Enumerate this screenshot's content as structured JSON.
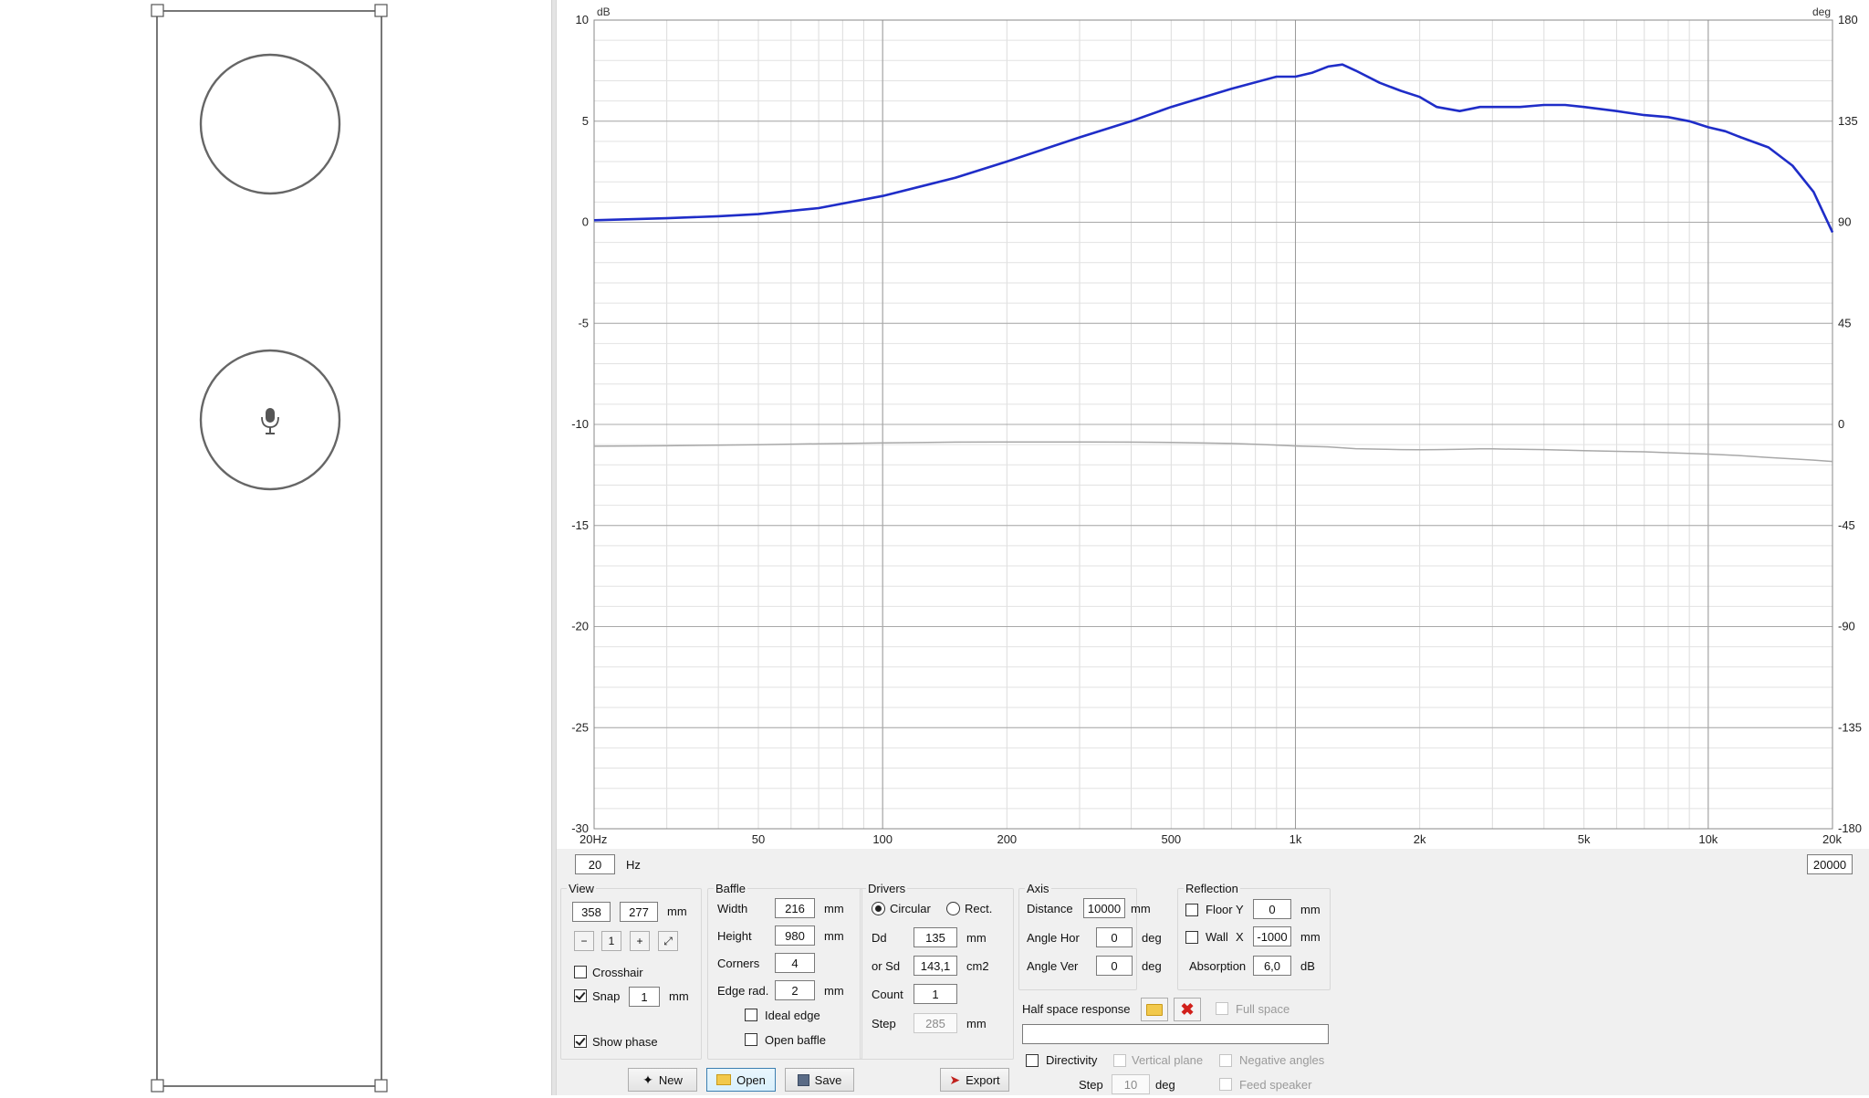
{
  "chart_data": {
    "type": "line",
    "x_scale": "log",
    "xlim": [
      20,
      20000
    ],
    "ylim": [
      -30,
      10
    ],
    "y2lim": [
      -180,
      180
    ],
    "ylabel": "dB",
    "y2label": "deg",
    "grid": true,
    "x_ticks": [
      {
        "v": 20,
        "label": "20Hz"
      },
      {
        "v": 50,
        "label": "50"
      },
      {
        "v": 100,
        "label": "100"
      },
      {
        "v": 200,
        "label": "200"
      },
      {
        "v": 500,
        "label": "500"
      },
      {
        "v": 1000,
        "label": "1k"
      },
      {
        "v": 2000,
        "label": "2k"
      },
      {
        "v": 5000,
        "label": "5k"
      },
      {
        "v": 10000,
        "label": "10k"
      },
      {
        "v": 20000,
        "label": "20k"
      }
    ],
    "y_ticks": [
      {
        "v": 10,
        "label": "10"
      },
      {
        "v": 5,
        "label": "5"
      },
      {
        "v": 0,
        "label": "0"
      },
      {
        "v": -5,
        "label": "-5"
      },
      {
        "v": -10,
        "label": "-10"
      },
      {
        "v": -15,
        "label": "-15"
      },
      {
        "v": -20,
        "label": "-20"
      },
      {
        "v": -25,
        "label": "-25"
      },
      {
        "v": -30,
        "label": "-30"
      }
    ],
    "y2_ticks": [
      {
        "v": 180,
        "label": "180"
      },
      {
        "v": 135,
        "label": "135"
      },
      {
        "v": 90,
        "label": "90"
      },
      {
        "v": 45,
        "label": "45"
      },
      {
        "v": 0,
        "label": "0"
      },
      {
        "v": -45,
        "label": "-45"
      },
      {
        "v": -90,
        "label": "-90"
      },
      {
        "v": -135,
        "label": "-135"
      },
      {
        "v": -180,
        "label": "-180"
      }
    ],
    "series": [
      {
        "axis": "left",
        "color": "#1f2dc8",
        "x": [
          20,
          30,
          40,
          50,
          70,
          100,
          150,
          200,
          300,
          400,
          500,
          700,
          900,
          1000,
          1100,
          1200,
          1300,
          1400,
          1600,
          1800,
          2000,
          2200,
          2500,
          2800,
          3000,
          3500,
          4000,
          4500,
          5000,
          6000,
          7000,
          8000,
          9000,
          10000,
          11000,
          12000,
          14000,
          16000,
          18000,
          20000
        ],
        "y": [
          0.1,
          0.2,
          0.3,
          0.4,
          0.7,
          1.3,
          2.2,
          3.0,
          4.2,
          5.0,
          5.7,
          6.6,
          7.2,
          7.2,
          7.4,
          7.7,
          7.8,
          7.5,
          6.9,
          6.5,
          6.2,
          5.7,
          5.5,
          5.7,
          5.7,
          5.7,
          5.8,
          5.8,
          5.7,
          5.5,
          5.3,
          5.2,
          5.0,
          4.7,
          4.5,
          4.2,
          3.7,
          2.8,
          1.5,
          -0.5
        ]
      },
      {
        "axis": "right",
        "color": "#a8a8a8",
        "x": [
          20,
          30,
          50,
          70,
          100,
          150,
          200,
          300,
          400,
          500,
          700,
          800,
          1000,
          1200,
          1400,
          1600,
          1800,
          2000,
          2200,
          2500,
          2800,
          3000,
          3500,
          4000,
          5000,
          6000,
          7000,
          8000,
          10000,
          12000,
          14000,
          16000,
          18000,
          20000
        ],
        "y": [
          -9.7,
          -9.5,
          -9.0,
          -8.6,
          -8.2,
          -7.9,
          -7.8,
          -7.8,
          -7.9,
          -8.0,
          -8.5,
          -8.8,
          -9.6,
          -10.0,
          -10.8,
          -11.0,
          -11.2,
          -11.3,
          -11.2,
          -11.1,
          -10.9,
          -10.9,
          -11.1,
          -11.2,
          -11.7,
          -12.0,
          -12.2,
          -12.6,
          -13.2,
          -13.9,
          -14.7,
          -15.3,
          -15.9,
          -16.5
        ]
      }
    ]
  },
  "baffle_view": {
    "mic_icon": "microphone-icon"
  },
  "range": {
    "min": "20",
    "min_unit": "Hz",
    "max": "20000"
  },
  "view": {
    "title": "View",
    "x": "358",
    "y": "277",
    "unit": "mm",
    "crosshair_label": "Crosshair",
    "crosshair_checked": false,
    "snap_label": "Snap",
    "snap_checked": true,
    "snap_value": "1",
    "snap_unit": "mm",
    "show_phase_label": "Show phase",
    "show_phase_checked": true
  },
  "baffle": {
    "title": "Baffle",
    "width_label": "Width",
    "width": "216",
    "height_label": "Height",
    "height": "980",
    "corners_label": "Corners",
    "corners": "4",
    "edge_rad_label": "Edge rad.",
    "edge_rad": "2",
    "unit": "mm",
    "ideal_edge_label": "Ideal edge",
    "open_baffle_label": "Open baffle"
  },
  "drivers": {
    "title": "Drivers",
    "circular_label": "Circular",
    "rect_label": "Rect.",
    "dd_label": "Dd",
    "dd": "135",
    "dd_unit": "mm",
    "sd_label": "or Sd",
    "sd": "143,1",
    "sd_unit": "cm2",
    "count_label": "Count",
    "count": "1",
    "step_label": "Step",
    "step": "285",
    "step_unit": "mm"
  },
  "axis": {
    "title": "Axis",
    "distance_label": "Distance",
    "distance": "10000",
    "distance_unit": "mm",
    "angle_hor_label": "Angle Hor",
    "angle_hor": "0",
    "angle_ver_label": "Angle Ver",
    "angle_ver": "0",
    "angle_unit": "deg"
  },
  "reflection": {
    "title": "Reflection",
    "floor_label": "Floor Y",
    "floor": "0",
    "wall_label": "Wall",
    "wall_axis": "X",
    "wall": "-1000",
    "unit": "mm",
    "absorption_label": "Absorption",
    "absorption": "6,0",
    "absorption_unit": "dB"
  },
  "half_space": {
    "label": "Half space response",
    "full_space_label": "Full space",
    "path": ""
  },
  "directivity": {
    "label": "Directivity",
    "vertical_plane_label": "Vertical plane",
    "negative_angles_label": "Negative angles",
    "step_label": "Step",
    "step": "10",
    "step_unit": "deg",
    "feed_speaker_label": "Feed speaker"
  },
  "buttons": {
    "new": "New",
    "open": "Open",
    "save": "Save",
    "export": "Export"
  }
}
